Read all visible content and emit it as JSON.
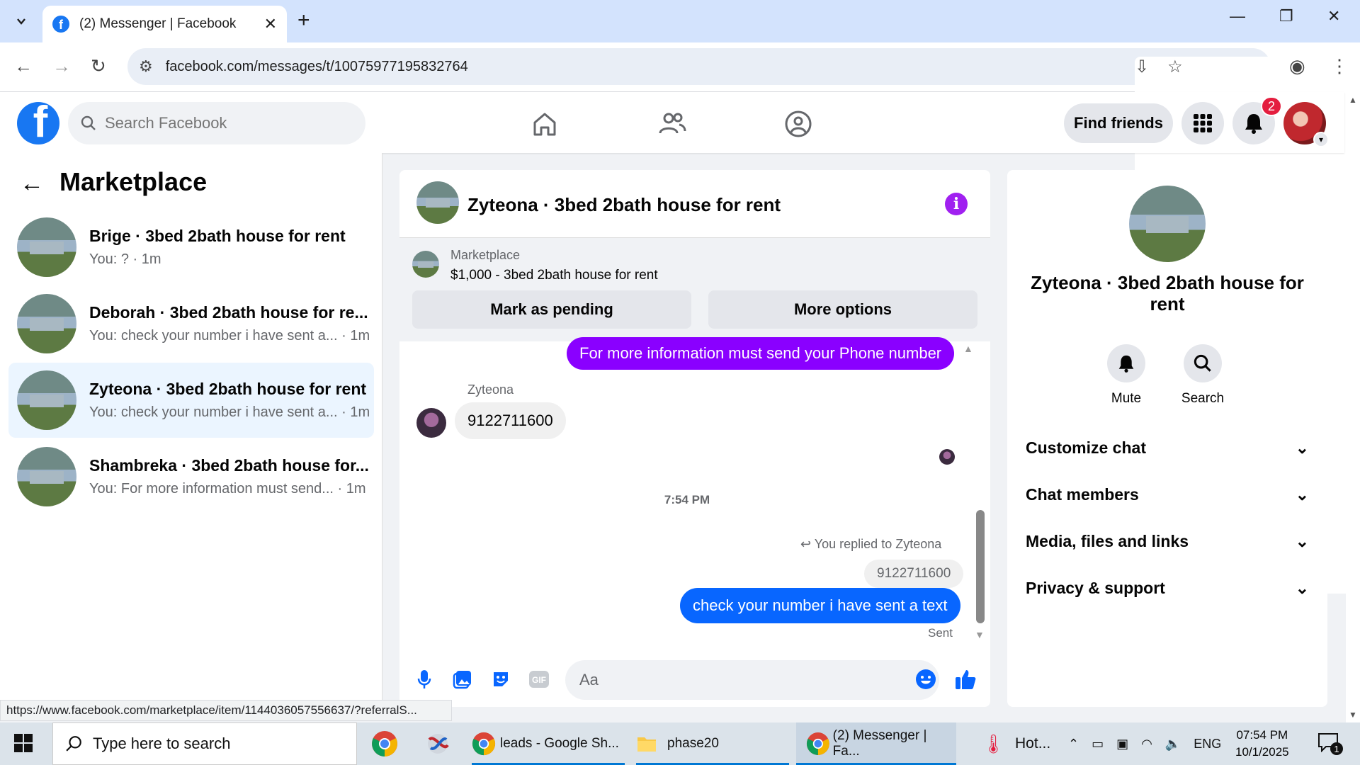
{
  "browser": {
    "tab_title": "(2) Messenger | Facebook",
    "url": "facebook.com/messages/t/10075977195832764",
    "status_url": "https://www.facebook.com/marketplace/item/1144036057556637/?referralS..."
  },
  "fb": {
    "search_placeholder": "Search Facebook",
    "find_friends": "Find friends",
    "notification_count": "2"
  },
  "left": {
    "title": "Marketplace",
    "conversations": [
      {
        "name": "Brige · 3bed 2bath house for rent",
        "preview": "You: ? · 1m"
      },
      {
        "name": "Deborah · 3bed 2bath house for re...",
        "preview": "You: check your number i have sent a... · 1m"
      },
      {
        "name": "Zyteona · 3bed 2bath house for rent",
        "preview": "You: check your number i have sent a... · 1m"
      },
      {
        "name": "Shambreka · 3bed 2bath house for...",
        "preview": "You: For more information must send... · 1m"
      }
    ]
  },
  "chat": {
    "title": "Zyteona · 3bed 2bath house for rent",
    "listing_label": "Marketplace",
    "listing_price": "$1,000 - 3bed 2bath house for rent",
    "mark_pending": "Mark as pending",
    "more_options": "More options",
    "msg_out_1": "For more information must send your Phone number",
    "sender_name": "Zyteona",
    "msg_in_1": "9122711600",
    "timestamp": "7:54 PM",
    "replied_to": "You replied to Zyteona",
    "quoted": "9122711600",
    "msg_out_2": "check your number i have sent a text",
    "sent_status": "Sent",
    "input_placeholder": "Aa"
  },
  "right": {
    "name": "Zyteona · 3bed 2bath house for rent",
    "mute": "Mute",
    "search": "Search",
    "rows": [
      "Customize chat",
      "Chat members",
      "Media, files and links",
      "Privacy & support"
    ]
  },
  "taskbar": {
    "search_placeholder": "Type here to search",
    "items": [
      "leads - Google Sh...",
      "phase20",
      "(2) Messenger | Fa...",
      "Hot..."
    ],
    "lang": "ENG",
    "time": "07:54 PM",
    "date": "10/1/2025",
    "notif_count": "1"
  }
}
